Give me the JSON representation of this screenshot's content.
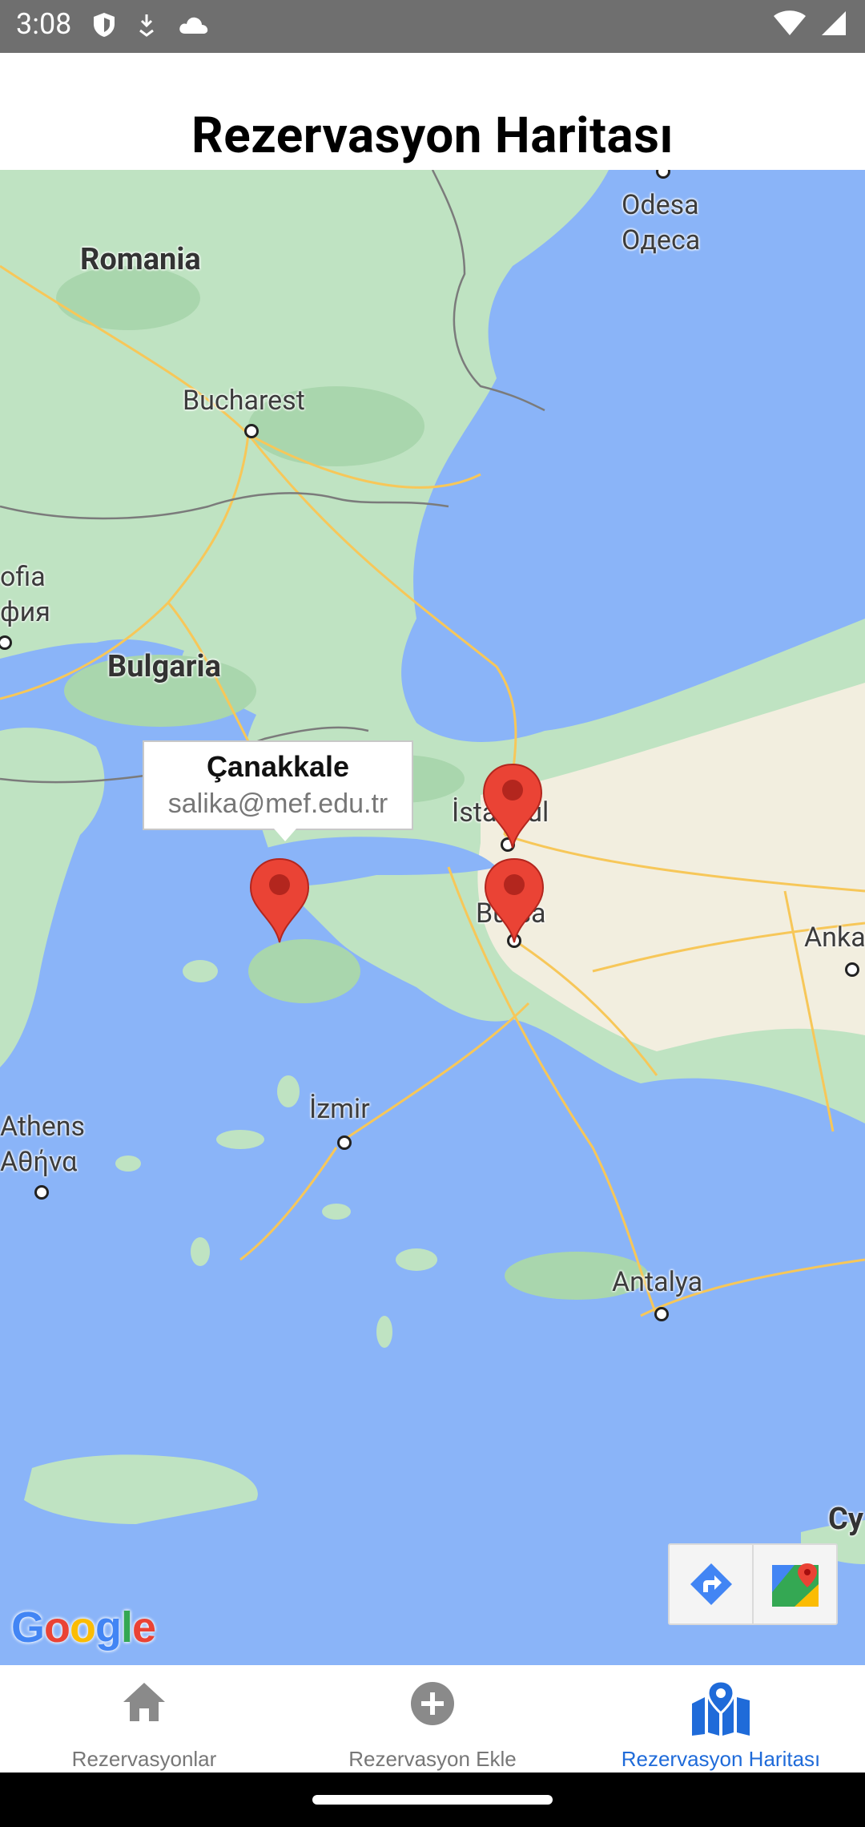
{
  "status_bar": {
    "time": "3:08",
    "left_icons": [
      "shield-icon",
      "download-icon",
      "cloud-icon"
    ],
    "right_icons": [
      "wifi-icon",
      "signal-icon",
      "battery-icon"
    ]
  },
  "header": {
    "title": "Rezervasyon Haritası"
  },
  "map": {
    "labels": {
      "romania": "Romania",
      "bulgaria": "Bulgaria",
      "bucharest": "Bucharest",
      "odesa": "Odesa",
      "odesa_cyr": "Одеса",
      "sofia": "ofia",
      "sofia_cyr": "фия",
      "istanbul": "İstanbul",
      "bursa": "Bursa",
      "izmir": "İzmir",
      "athens": "Athens",
      "athens_gr": "Αθήνα",
      "antalya": "Antalya",
      "ankara": "Anka",
      "cyprus": "Cy"
    },
    "info_window": {
      "title": "Çanakkale",
      "snippet": "salika@mef.edu.tr"
    },
    "markers": [
      "Çanakkale",
      "İstanbul",
      "Bursa"
    ],
    "google_logo": "Google",
    "colors": {
      "water": "#8ab4f8",
      "land": "#bfe3c2",
      "marker": "#ea4335"
    }
  },
  "bottom_nav": {
    "items": [
      {
        "label": "Rezervasyonlar",
        "icon": "home-icon"
      },
      {
        "label": "Rezervasyon Ekle",
        "icon": "add-circle-icon"
      },
      {
        "label": "Rezervasyon Haritası",
        "icon": "map-icon",
        "active": true
      }
    ],
    "active_color": "#1f6bd9"
  }
}
